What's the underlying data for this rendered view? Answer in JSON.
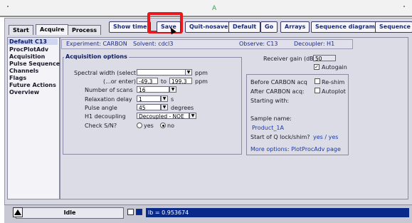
{
  "top": {
    "center_glyph": "A"
  },
  "tabs": [
    "Start",
    "Acquire",
    "Process"
  ],
  "toolbar": {
    "show_time": "Show time",
    "save": "Save",
    "quit_nosave": "Quit-nosave",
    "default": "Default",
    "go": "Go",
    "arrays": "Arrays",
    "sequence_diagram": "Sequence diagram",
    "sequence_h": "Sequence h"
  },
  "nav": [
    "Default C13",
    "ProcPlotAdv",
    "Acquisition",
    "Pulse Sequence",
    "Channels",
    "Flags",
    "Future Actions",
    "Overview"
  ],
  "experiment_bar": {
    "experiment": "Experiment: CARBON",
    "solvent": "Solvent: cdcl3",
    "observe": "Observe: C13",
    "decoupler": "Decoupler: H1"
  },
  "acq": {
    "title": "Acquisition options",
    "spectral_width_label": "Spectral width (select)",
    "spectral_width_value": "",
    "ppm": "ppm",
    "or_enter": "(...or enter)",
    "from": "-49.3",
    "to_label": "to",
    "to": "199.3",
    "scans_label": "Number of scans",
    "scans": "16",
    "relax_label": "Relaxation delay",
    "relax": "1",
    "s": "s",
    "pulse_label": "Pulse angle",
    "pulse": "45",
    "degrees": "degrees",
    "h1_label": "H1 decoupling",
    "h1": "Decoupled - NOE",
    "check_label": "Check S/N?",
    "yes": "yes",
    "no": "no"
  },
  "right": {
    "gain_label": "Receiver gain (dB)",
    "gain": "50",
    "autogain": "Autogain",
    "before_label": "Before CARBON acq",
    "reshim": "Re-shim",
    "after_label": "After CARBON acq:",
    "autoplot": "Autoplot",
    "starting": "Starting with:",
    "sample_label": "Sample name:",
    "sample": "Product_1A",
    "lock_label": "Start of Q lock/shim?",
    "lock_value": "yes / yes",
    "more": "More options: PlotProcAdv page"
  },
  "status": {
    "idle": "Idle",
    "command": "lb = 0.953674"
  },
  "colors": {
    "highlight": "#e8181e",
    "accent": "#0a2a8a"
  }
}
